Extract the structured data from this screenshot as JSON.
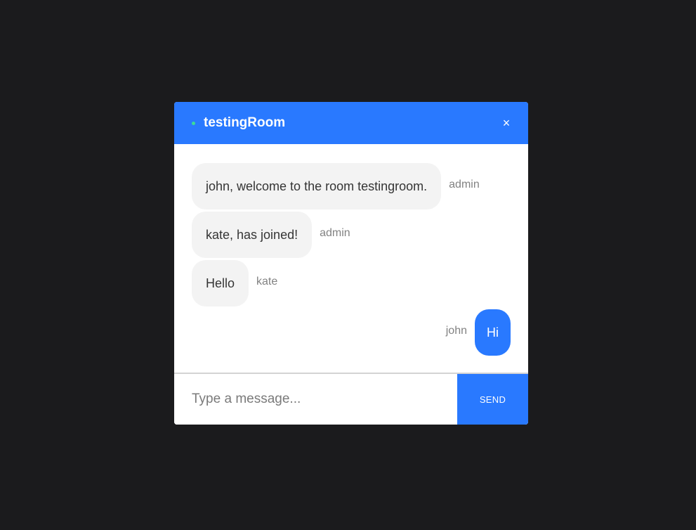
{
  "header": {
    "room_name": "testingRoom",
    "close_label": "×",
    "status": "online"
  },
  "messages": [
    {
      "text": "john, welcome to the room testingroom.",
      "sender": "admin",
      "from_self": false
    },
    {
      "text": "kate, has joined!",
      "sender": "admin",
      "from_self": false
    },
    {
      "text": "Hello",
      "sender": "kate",
      "from_self": false
    },
    {
      "text": "Hi",
      "sender": "john",
      "from_self": true
    }
  ],
  "composer": {
    "placeholder": "Type a message...",
    "value": "",
    "send_label": "SEND"
  },
  "colors": {
    "accent": "#2979ff",
    "status_online": "#3ddc97",
    "bubble_other": "#f3f3f3",
    "background": "#1b1b1d"
  }
}
